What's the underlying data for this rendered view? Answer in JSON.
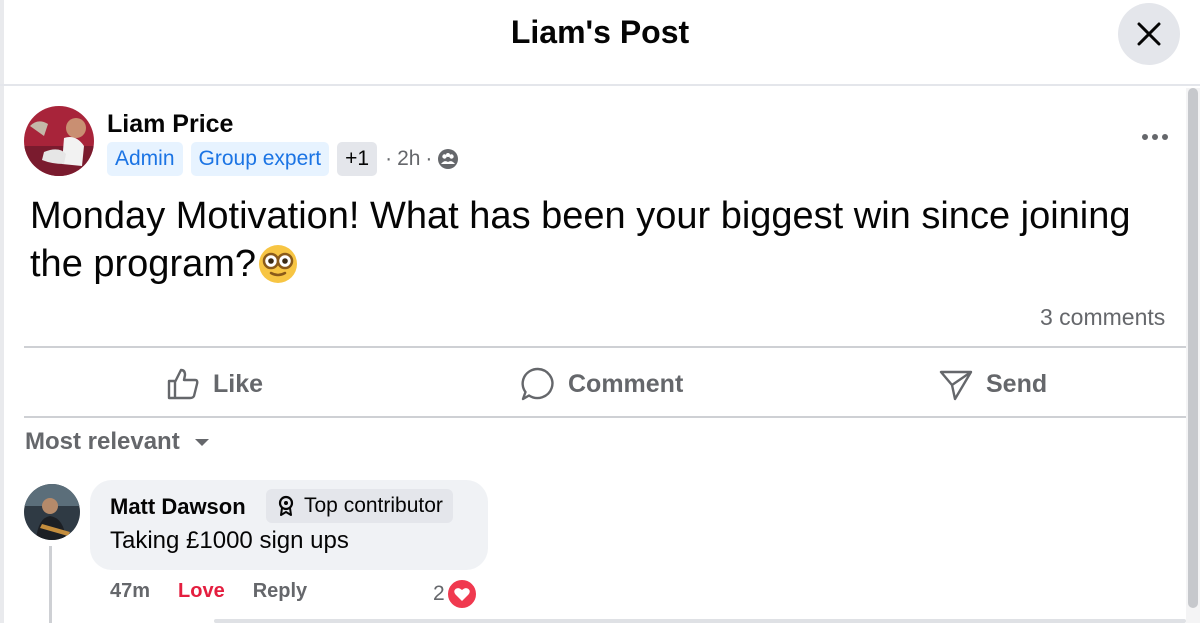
{
  "header": {
    "title": "Liam's Post"
  },
  "post": {
    "author": "Liam Price",
    "badges": [
      "Admin",
      "Group expert"
    ],
    "extra_badges": "+1",
    "time": "2h",
    "separator": "·",
    "text": "Monday Motivation! What has been your biggest win since joining the program?",
    "emoji": "nerd-face-emoji",
    "comments_count": "3 comments"
  },
  "actions": {
    "like": "Like",
    "comment": "Comment",
    "send": "Send"
  },
  "sort": {
    "label": "Most relevant"
  },
  "comments": [
    {
      "author": "Matt Dawson",
      "badge": "Top contributor",
      "text": "Taking £1000 sign ups",
      "time": "47m",
      "reaction_label": "Love",
      "reply_label": "Reply",
      "reaction_count": "2",
      "reaction_icon": "heart-icon"
    }
  ],
  "colors": {
    "badge_blue_bg": "#e7f3ff",
    "badge_blue_text": "#1b74e4",
    "love": "#e41e3f",
    "secondary_text": "#65676b"
  }
}
